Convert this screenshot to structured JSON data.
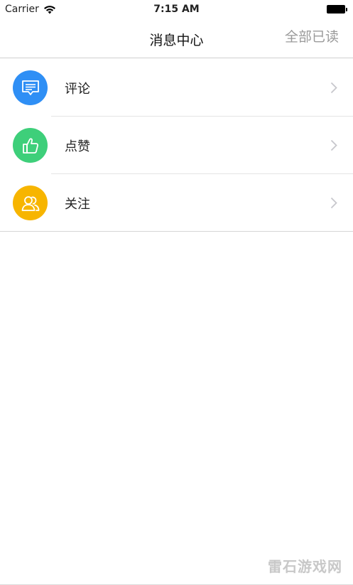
{
  "status_bar": {
    "carrier": "Carrier",
    "time": "7:15 AM"
  },
  "nav": {
    "title": "消息中心",
    "mark_all_read": "全部已读"
  },
  "list": {
    "items": [
      {
        "label": "评论",
        "icon": "comment-icon",
        "color": "#2f8ff5"
      },
      {
        "label": "点赞",
        "icon": "thumbs-up-icon",
        "color": "#3ecf7a"
      },
      {
        "label": "关注",
        "icon": "people-icon",
        "color": "#f7b500"
      }
    ]
  },
  "watermark": "雷石游戏网",
  "colors": {
    "nav_action": "#9a9a9a",
    "divider": "#e4e4e4"
  }
}
